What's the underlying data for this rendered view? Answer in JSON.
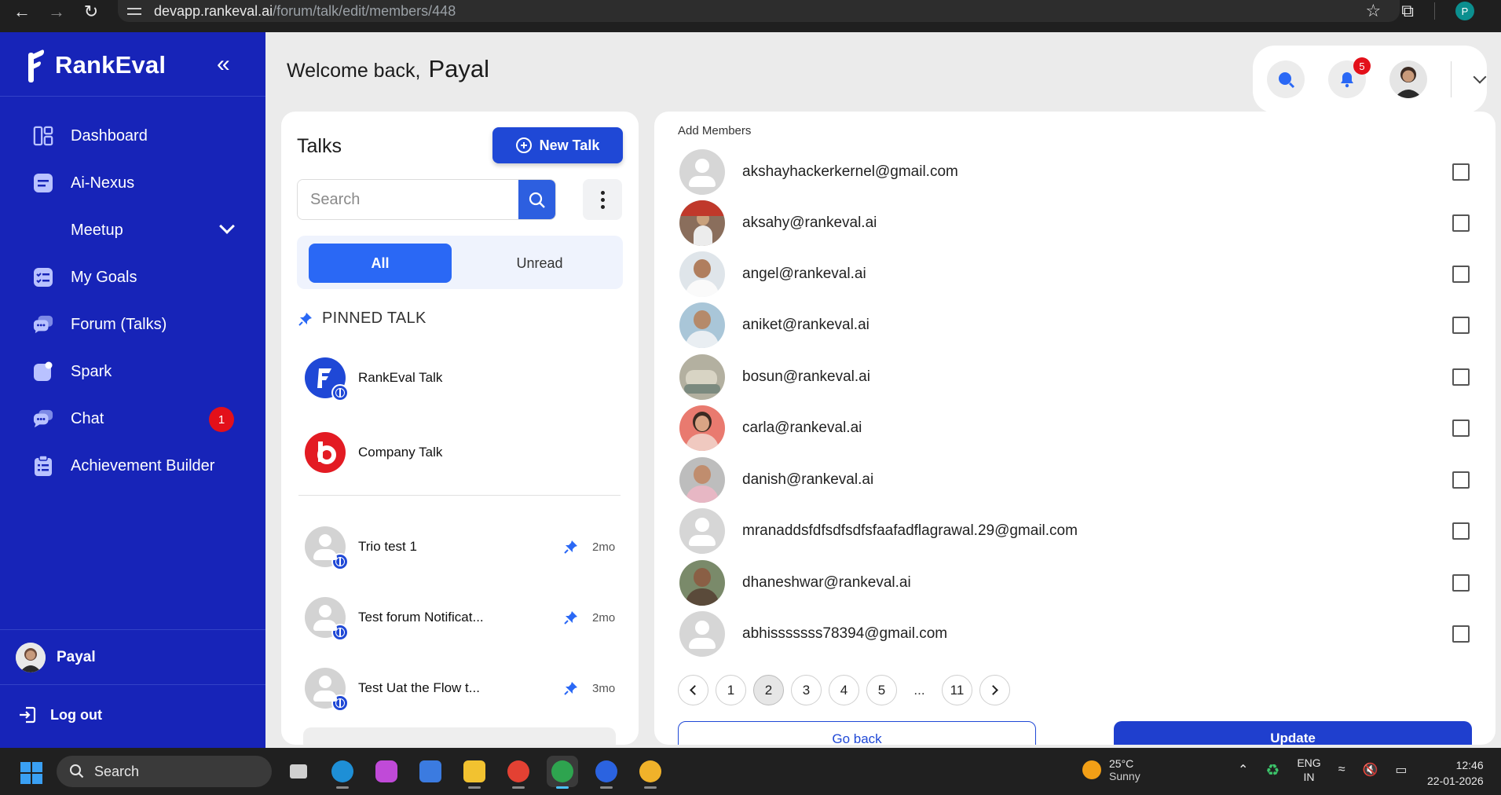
{
  "browser": {
    "url_host": "devapp.rankeval.ai",
    "url_path": "/forum/talk/edit/members/448",
    "profile_initial": "P"
  },
  "sidebar": {
    "brand": "RankEval",
    "items": [
      {
        "label": "Dashboard",
        "icon": "dashboard-icon"
      },
      {
        "label": "Ai-Nexus",
        "icon": "document-icon"
      },
      {
        "label": "Meetup",
        "icon": "chevron-down-icon"
      },
      {
        "label": "My Goals",
        "icon": "checklist-icon"
      },
      {
        "label": "Forum (Talks)",
        "icon": "chat-bubbles-icon"
      },
      {
        "label": "Spark",
        "icon": "spark-icon"
      },
      {
        "label": "Chat",
        "icon": "chat-icon",
        "badge": "1"
      },
      {
        "label": "Achievement Builder",
        "icon": "clipboard-icon"
      }
    ],
    "user_name": "Payal",
    "logout_label": "Log out"
  },
  "header": {
    "welcome": "Welcome back,",
    "user": "Payal",
    "notif_count": "5"
  },
  "talks": {
    "title": "Talks",
    "new_talk": "New Talk",
    "search_placeholder": "Search",
    "tab_all": "All",
    "tab_unread": "Unread",
    "pinned_header": "PINNED TALK",
    "pinned": [
      {
        "name": "RankEval Talk"
      },
      {
        "name": "Company Talk"
      }
    ],
    "list": [
      {
        "name": "Trio test 1",
        "age": "2mo"
      },
      {
        "name": "Test forum Notificat...",
        "age": "2mo"
      },
      {
        "name": "Test Uat the Flow t...",
        "age": "3mo"
      }
    ]
  },
  "members": {
    "title": "Add Members",
    "rows": [
      {
        "email": "akshayhackerkernel@gmail.com"
      },
      {
        "email": "aksahy@rankeval.ai"
      },
      {
        "email": "angel@rankeval.ai"
      },
      {
        "email": "aniket@rankeval.ai"
      },
      {
        "email": "bosun@rankeval.ai"
      },
      {
        "email": "carla@rankeval.ai"
      },
      {
        "email": "danish@rankeval.ai"
      },
      {
        "email": "mranaddsfdfsdfsdfsfaafadflagrawal.29@gmail.com"
      },
      {
        "email": "dhaneshwar@rankeval.ai"
      },
      {
        "email": "abhisssssss78394@gmail.com"
      }
    ],
    "pages": [
      "1",
      "2",
      "3",
      "4",
      "5"
    ],
    "current_page": "2",
    "ellipsis": "...",
    "last_page": "11",
    "go_back": "Go back",
    "update": "Update"
  },
  "taskbar": {
    "search": "Search",
    "temp": "25°C",
    "weather": "Sunny",
    "lang1": "ENG",
    "lang2": "IN",
    "time": "12:46",
    "date": "22-01-2026"
  }
}
